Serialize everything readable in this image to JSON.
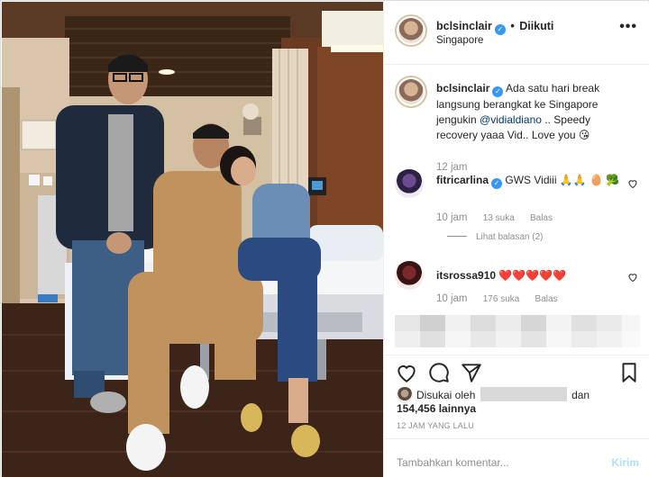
{
  "header": {
    "username": "bclsinclair",
    "dot": "•",
    "follow_label": "Diikuti",
    "location": "Singapore",
    "more": "•••"
  },
  "caption": {
    "username": "bclsinclair",
    "text_before": " Ada satu hari break langsung berangkat ke Singapore jengukin ",
    "mention": "@vidialdiano",
    "text_after": " .. Speedy recovery yaaa Vid.. Love you 😘",
    "time": "12 jam"
  },
  "comments": [
    {
      "username": "fitricarlina",
      "text": " GWS Vidiii 🙏🙏 🥚 🥦",
      "time": "10 jam",
      "likes": "13 suka",
      "reply": "Balas",
      "view_replies": "Lihat balasan (2)"
    },
    {
      "username": "itsrossa910",
      "text": " ❤️❤️❤️❤️❤️",
      "time": "10 jam",
      "likes": "176 suka",
      "reply": "Balas"
    }
  ],
  "likes": {
    "prefix": "Disukai oleh",
    "suffix": "dan",
    "count": "154,456 lainnya"
  },
  "time_ago": "12 JAM YANG LALU",
  "add_comment": {
    "placeholder": "Tambahkan komentar...",
    "post_label": "Kirim"
  },
  "icons": [
    "heart-icon",
    "comment-icon",
    "share-icon",
    "save-icon",
    "verified-icon",
    "more-icon"
  ],
  "colors": {
    "verified": "#3897f0",
    "mention": "#00376b",
    "post_disabled": "#b2dffc",
    "secondary_text": "#8e8e8e",
    "heart_red": "#ed4956"
  }
}
